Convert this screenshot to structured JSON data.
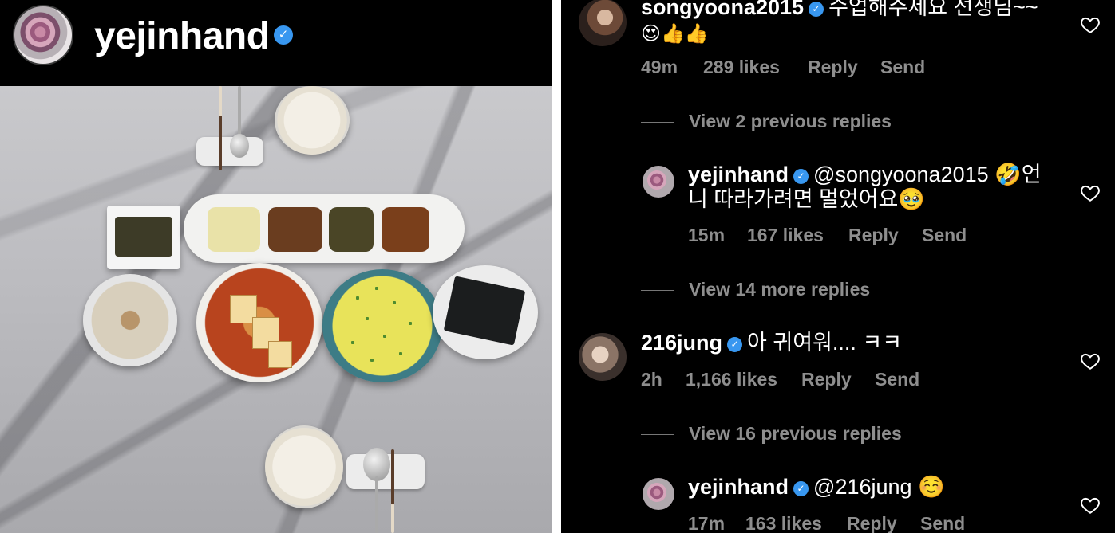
{
  "post": {
    "username": "yejinhand",
    "verified_icon": "verified-badge-icon"
  },
  "comments": [
    {
      "username": "songyoona2015",
      "text": "수업해주세요 선생님~~",
      "emoji_line": "😍👍👍",
      "time": "49m",
      "likes": "289 likes",
      "reply": "Reply",
      "send": "Send"
    },
    {
      "view_replies": "View 2 previous replies"
    },
    {
      "username": "yejinhand",
      "text_line1": "@songyoona2015 🤣언",
      "text_line2": "니 따라가려면 멀었어요🥹",
      "time": "15m",
      "likes": "167 likes",
      "reply": "Reply",
      "send": "Send"
    },
    {
      "view_replies": "View 14 more replies"
    },
    {
      "username": "216jung",
      "text": "아 귀여워.... ㅋㅋ",
      "time": "2h",
      "likes": "1,166 likes",
      "reply": "Reply",
      "send": "Send"
    },
    {
      "view_replies": "View 16 previous replies"
    },
    {
      "username": "yejinhand",
      "text": "@216jung ☺️",
      "time": "17m",
      "likes": "163 likes",
      "reply": "Reply",
      "send": "Send"
    }
  ],
  "colors": {
    "background": "#000000",
    "verified": "#3897f0",
    "meta_text": "#8e8e8e"
  }
}
